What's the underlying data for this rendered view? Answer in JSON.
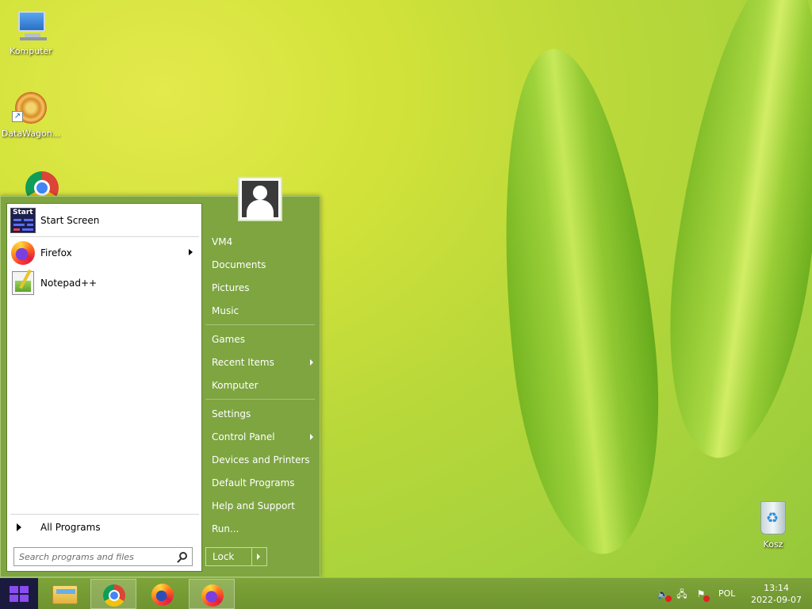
{
  "desktop": {
    "icons": [
      {
        "label": "Komputer"
      },
      {
        "label": "DataWagon..."
      },
      {
        "label": ""
      },
      {
        "label": "Kosz"
      }
    ]
  },
  "start_menu": {
    "pinned": [
      {
        "label": "Start Screen",
        "icon": "start-screen-icon"
      },
      {
        "label": "Firefox",
        "icon": "firefox-icon",
        "has_submenu": true
      },
      {
        "label": "Notepad++",
        "icon": "notepad-plus-plus-icon"
      }
    ],
    "all_programs": "All Programs",
    "search_placeholder": "Search programs and files",
    "start_tile_text": "Start",
    "right": {
      "group1": [
        "VM4",
        "Documents",
        "Pictures",
        "Music"
      ],
      "group2": [
        "Games",
        "Recent Items",
        "Komputer"
      ],
      "group3": [
        "Settings",
        "Control Panel",
        "Devices and Printers",
        "Default Programs",
        "Help and Support",
        "Run..."
      ]
    },
    "lock_label": "Lock"
  },
  "taskbar": {
    "language": "POL",
    "time": "13:14",
    "date": "2022-09-07"
  },
  "colors": {
    "menu_green": "#7ea540",
    "taskbar_green": "#759b34",
    "start_button": "#1a1a3f",
    "windows_logo": "#8a4cf0"
  }
}
